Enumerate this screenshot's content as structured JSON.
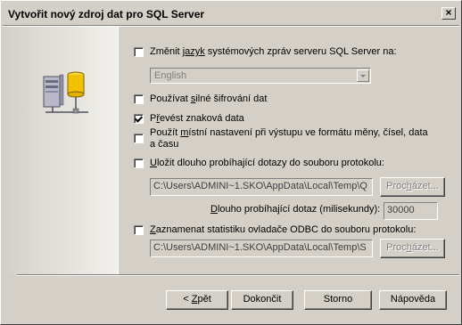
{
  "window": {
    "title": "Vytvořit nový zdroj dat pro SQL Server",
    "close_label": "×"
  },
  "options": {
    "change_language": {
      "label_pre": "Změnit ",
      "label_u": "jazyk",
      "label_post": " systémových zpráv serveru SQL Server na:",
      "checked": false
    },
    "language_select": {
      "value": "English"
    },
    "strong_encryption": {
      "label_pre": "Používat ",
      "label_u": "s",
      "label_post": "ilné šifrování dat",
      "checked": false
    },
    "translate_char": {
      "label_pre": "P",
      "label_u": "ř",
      "label_post": "evést znaková data",
      "checked": true
    },
    "regional_settings": {
      "label_line1_pre": "Použít ",
      "label_u": "m",
      "label_line1_post": "ístní nastavení při výstupu ve formátu měny, čísel, data",
      "label_line2": "a času",
      "checked": false
    },
    "log_long_queries": {
      "label_pre": "",
      "label_u": "U",
      "label_post": "ložit dlouho probíhající dotazy do souboru protokolu:",
      "checked": false
    },
    "long_query_file": {
      "value": "C:\\Users\\ADMINI~1.SKO\\AppData\\Local\\Temp\\Q"
    },
    "long_query_browse": {
      "label_pre": "Proc",
      "label_u": "h",
      "label_post": "ázet..."
    },
    "long_query_time": {
      "label_pre": "",
      "label_u": "D",
      "label_post": "louho probíhající dotaz (milisekundy):",
      "value": "30000"
    },
    "log_odbc_stats": {
      "label_pre": "",
      "label_u": "Z",
      "label_post": "aznamenat statistiku ovladače ODBC do souboru protokolu:",
      "checked": false
    },
    "stats_file": {
      "value": "C:\\Users\\ADMINI~1.SKO\\AppData\\Local\\Temp\\S"
    },
    "stats_browse": {
      "label_pre": "Proc",
      "label_u": "h",
      "label_post": "ázet..."
    }
  },
  "buttons": {
    "back": {
      "label_pre": "< ",
      "label_u": "Z",
      "label_post": "pět"
    },
    "finish": {
      "label": "Dokončit"
    },
    "cancel": {
      "label": "Storno"
    },
    "help": {
      "label": "Nápověda"
    }
  },
  "colors": {
    "face": "#d4d0c8",
    "shadow": "#808080",
    "highlight": "#ffffff",
    "icon_yellow": "#f2c200"
  }
}
